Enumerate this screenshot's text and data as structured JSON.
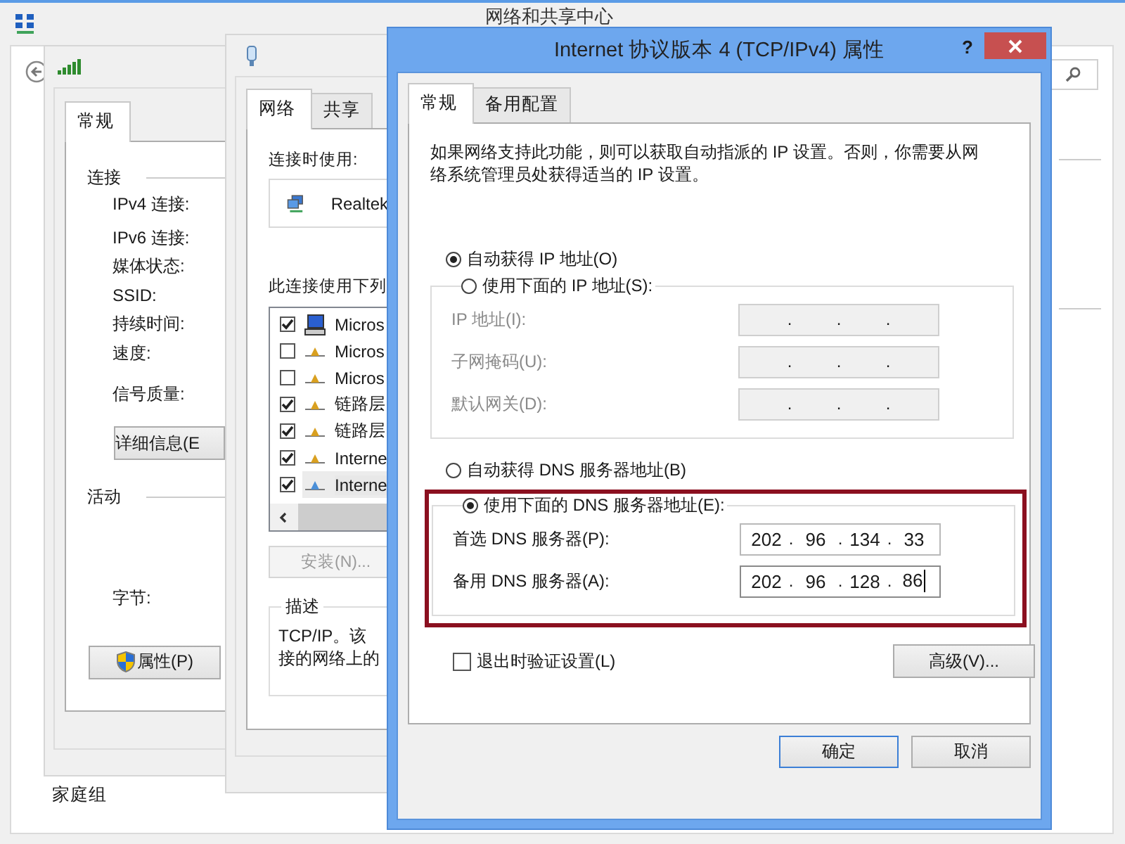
{
  "network_center": {
    "title": "网络和共享中心",
    "footer_link": "家庭组"
  },
  "status_window": {
    "tabs": [
      {
        "label": "常规",
        "selected": true
      }
    ],
    "connection_heading": "连接",
    "connection_fields": [
      "IPv4 连接:",
      "IPv6 连接:",
      "媒体状态:",
      "SSID:",
      "持续时间:",
      "速度:"
    ],
    "signal_label": "信号质量:",
    "details_button": "详细信息(E",
    "activity_heading": "活动",
    "bytes_label": "字节:",
    "properties_button": "属性(P)"
  },
  "properties_window": {
    "tabs": [
      {
        "label": "网络",
        "selected": true
      },
      {
        "label": "共享",
        "selected": false
      }
    ],
    "connect_using_label": "连接时使用:",
    "adapter": "Realtek",
    "items_label": "此连接使用下列",
    "items": [
      {
        "kind": "client",
        "label": "Micros",
        "checked": true,
        "selected": false
      },
      {
        "kind": "service",
        "label": "Micros",
        "checked": false,
        "selected": false
      },
      {
        "kind": "service",
        "label": "Micros",
        "checked": false,
        "selected": false
      },
      {
        "kind": "protocol",
        "label": "链路层",
        "checked": true,
        "selected": false
      },
      {
        "kind": "protocol",
        "label": "链路层",
        "checked": true,
        "selected": false
      },
      {
        "kind": "protocol",
        "label": "Interne",
        "checked": true,
        "selected": false
      },
      {
        "kind": "protocol",
        "label": "Interne",
        "checked": true,
        "selected": true
      }
    ],
    "install_button": {
      "label": "安装(N)...",
      "disabled": true
    },
    "description": {
      "title": "描述",
      "lines": [
        "TCP/IP。该",
        "接的网络上的"
      ]
    }
  },
  "dialog": {
    "title": "Internet 协议版本 4 (TCP/IPv4) 属性",
    "help_button": "?",
    "tabs": [
      {
        "label": "常规",
        "selected": true
      },
      {
        "label": "备用配置",
        "selected": false
      }
    ],
    "intro": "如果网络支持此功能，则可以获取自动指派的 IP 设置。否则，你需要从网络系统管理员处获得适当的 IP 设置。",
    "ip_options": [
      {
        "label": "自动获得 IP 地址(O)",
        "selected": true
      },
      {
        "label": "使用下面的 IP 地址(S):",
        "selected": false
      }
    ],
    "separator": ".",
    "ip_fields": [
      {
        "label": "IP 地址(I):",
        "disabled": true
      },
      {
        "label": "子网掩码(U):",
        "disabled": true
      },
      {
        "label": "默认网关(D):",
        "disabled": true
      }
    ],
    "dns_options": [
      {
        "label": "自动获得 DNS 服务器地址(B)",
        "selected": false
      },
      {
        "label": "使用下面的 DNS 服务器地址(E):",
        "selected": true
      }
    ],
    "dns_fields": [
      {
        "label": "首选 DNS 服务器(P):",
        "octets": [
          "202",
          "96",
          "134",
          "33"
        ],
        "disabled": false,
        "focused": false
      },
      {
        "label": "备用 DNS 服务器(A):",
        "octets": [
          "202",
          "96",
          "128",
          "86"
        ],
        "disabled": false,
        "focused": true
      }
    ],
    "dns_highlighted": true,
    "validate_on_exit": {
      "label": "退出时验证设置(L)",
      "checked": false
    },
    "advanced_button": "高级(V)...",
    "ok_button": {
      "label": "确定",
      "default": true
    },
    "cancel_button": "取消"
  }
}
